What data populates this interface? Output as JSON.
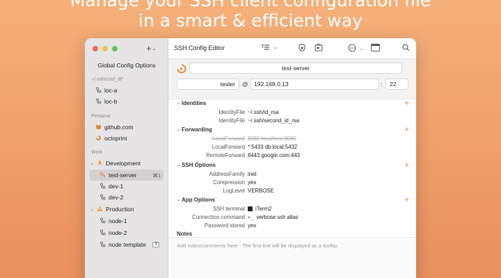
{
  "hero": {
    "line1": "Manage your SSH client configuration file",
    "line2": "in a smart & efficient way"
  },
  "window": {
    "traffic_lights": [
      "#ee6a5f",
      "#f5be4f",
      "#62c554"
    ],
    "accent": "#f08a3a"
  },
  "sidebar": {
    "add_label": "+",
    "add_chevron": "⌄",
    "global_config": "Global Config Options",
    "file_path": "~/.ssh/conf_d/*",
    "file_items": [
      {
        "label": "loc-a",
        "icon": "network-icon"
      },
      {
        "label": "loc-b",
        "icon": "network-icon"
      }
    ],
    "personal_label": "Personal",
    "personal_items": [
      {
        "label": "github.com",
        "icon": "github-icon"
      },
      {
        "label": "octoprint",
        "icon": "octoprint-icon"
      }
    ],
    "work_label": "Work",
    "development": {
      "label": "Development",
      "items": [
        {
          "label": "test-server",
          "badge": "⌘1",
          "selected": true
        },
        {
          "label": "dev-1"
        },
        {
          "label": "dev-2"
        }
      ]
    },
    "production": {
      "label": "Production",
      "items": [
        {
          "label": "node-1"
        },
        {
          "label": "node-2"
        },
        {
          "label": "node template",
          "badge": "T"
        }
      ]
    }
  },
  "toolbar": {
    "title": "SSH Config Editor"
  },
  "host": {
    "name": "test-server",
    "user": "tester",
    "at": "@",
    "address": "192.168.0.13",
    "colon": ":",
    "port": "22"
  },
  "sections": {
    "identities": {
      "title": "Identities",
      "rows": [
        {
          "key": "IdentityFile",
          "value": "~/.ssh/id_rsa"
        },
        {
          "key": "IdentityFile",
          "value": "~/.ssh/second_id_rsa"
        }
      ]
    },
    "forwarding": {
      "title": "Forwarding",
      "rows": [
        {
          "key": "LocalForward",
          "value": "8080 localhost:8080",
          "disabled": true
        },
        {
          "key": "LocalForward",
          "value": "*:5433 db.local:5432"
        },
        {
          "key": "RemoteForward",
          "value": "8443 google.com:443"
        }
      ]
    },
    "ssh_options": {
      "title": "SSH Options",
      "rows": [
        {
          "key": "AddressFamily",
          "value": "inet"
        },
        {
          "key": "Compression",
          "value": "yes"
        },
        {
          "key": "LogLevel",
          "value": "VERBOSE"
        }
      ]
    },
    "app_options": {
      "title": "App Options",
      "rows": [
        {
          "key": "SSH terminal",
          "value": "iTerm2"
        },
        {
          "key": "Connection command",
          "value": "verbose ssh alias",
          "prefix": ">_"
        },
        {
          "key": "Password stored",
          "value": "yes"
        }
      ]
    },
    "notes": {
      "title": "Notes",
      "placeholder": "Add notes/comments here - The first line will be displayed as a tooltip."
    }
  }
}
